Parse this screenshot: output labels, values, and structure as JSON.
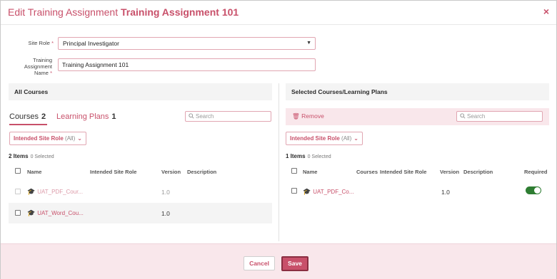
{
  "header": {
    "title_prefix": "Edit Training Assignment",
    "title_name": "Training Assignment 101",
    "close_glyph": "×"
  },
  "form": {
    "site_role_label": "Site Role",
    "site_role_value": "Principal Investigator",
    "name_label_line1": "Training",
    "name_label_line2": "Assignment",
    "name_label_line3": "Name",
    "name_value": "Training Assignment 101",
    "required_mark": "*"
  },
  "left_panel": {
    "heading": "All Courses",
    "tabs": [
      {
        "label": "Courses",
        "count": "2"
      },
      {
        "label": "Learning Plans",
        "count": "1"
      }
    ],
    "search_placeholder": "Search",
    "filter_label": "Intended Site Role",
    "filter_value": "(All)",
    "items_count": "2 Items",
    "selected_count": "0 Selected",
    "columns": [
      "Name",
      "Intended Site Role",
      "Version",
      "Description"
    ],
    "rows": [
      {
        "name": "UAT_PDF_Cour...",
        "role": "",
        "version": "1.0",
        "description": ""
      },
      {
        "name": "UAT_Word_Cou...",
        "role": "",
        "version": "1.0",
        "description": ""
      }
    ]
  },
  "right_panel": {
    "heading": "Selected Courses/Learning Plans",
    "remove_label": "Remove",
    "search_placeholder": "Search",
    "filter_label": "Intended Site Role",
    "filter_value": "(All)",
    "items_count": "1 Items",
    "selected_count": "0 Selected",
    "columns": [
      "Name",
      "Courses",
      "Intended Site Role",
      "Version",
      "Description",
      "Required"
    ],
    "rows": [
      {
        "name": "UAT_PDF_Co...",
        "courses": "",
        "role": "",
        "version": "1.0",
        "description": "",
        "required": true
      }
    ]
  },
  "footer": {
    "cancel_label": "Cancel",
    "save_label": "Save"
  },
  "colors": {
    "accent": "#c8506a",
    "toggle_on": "#2e7d32",
    "footer_bg": "#f9e7eb"
  },
  "icons": {
    "course": "graduation-cap-icon",
    "remove": "trash-icon",
    "search": "search-icon",
    "close": "close-icon"
  }
}
